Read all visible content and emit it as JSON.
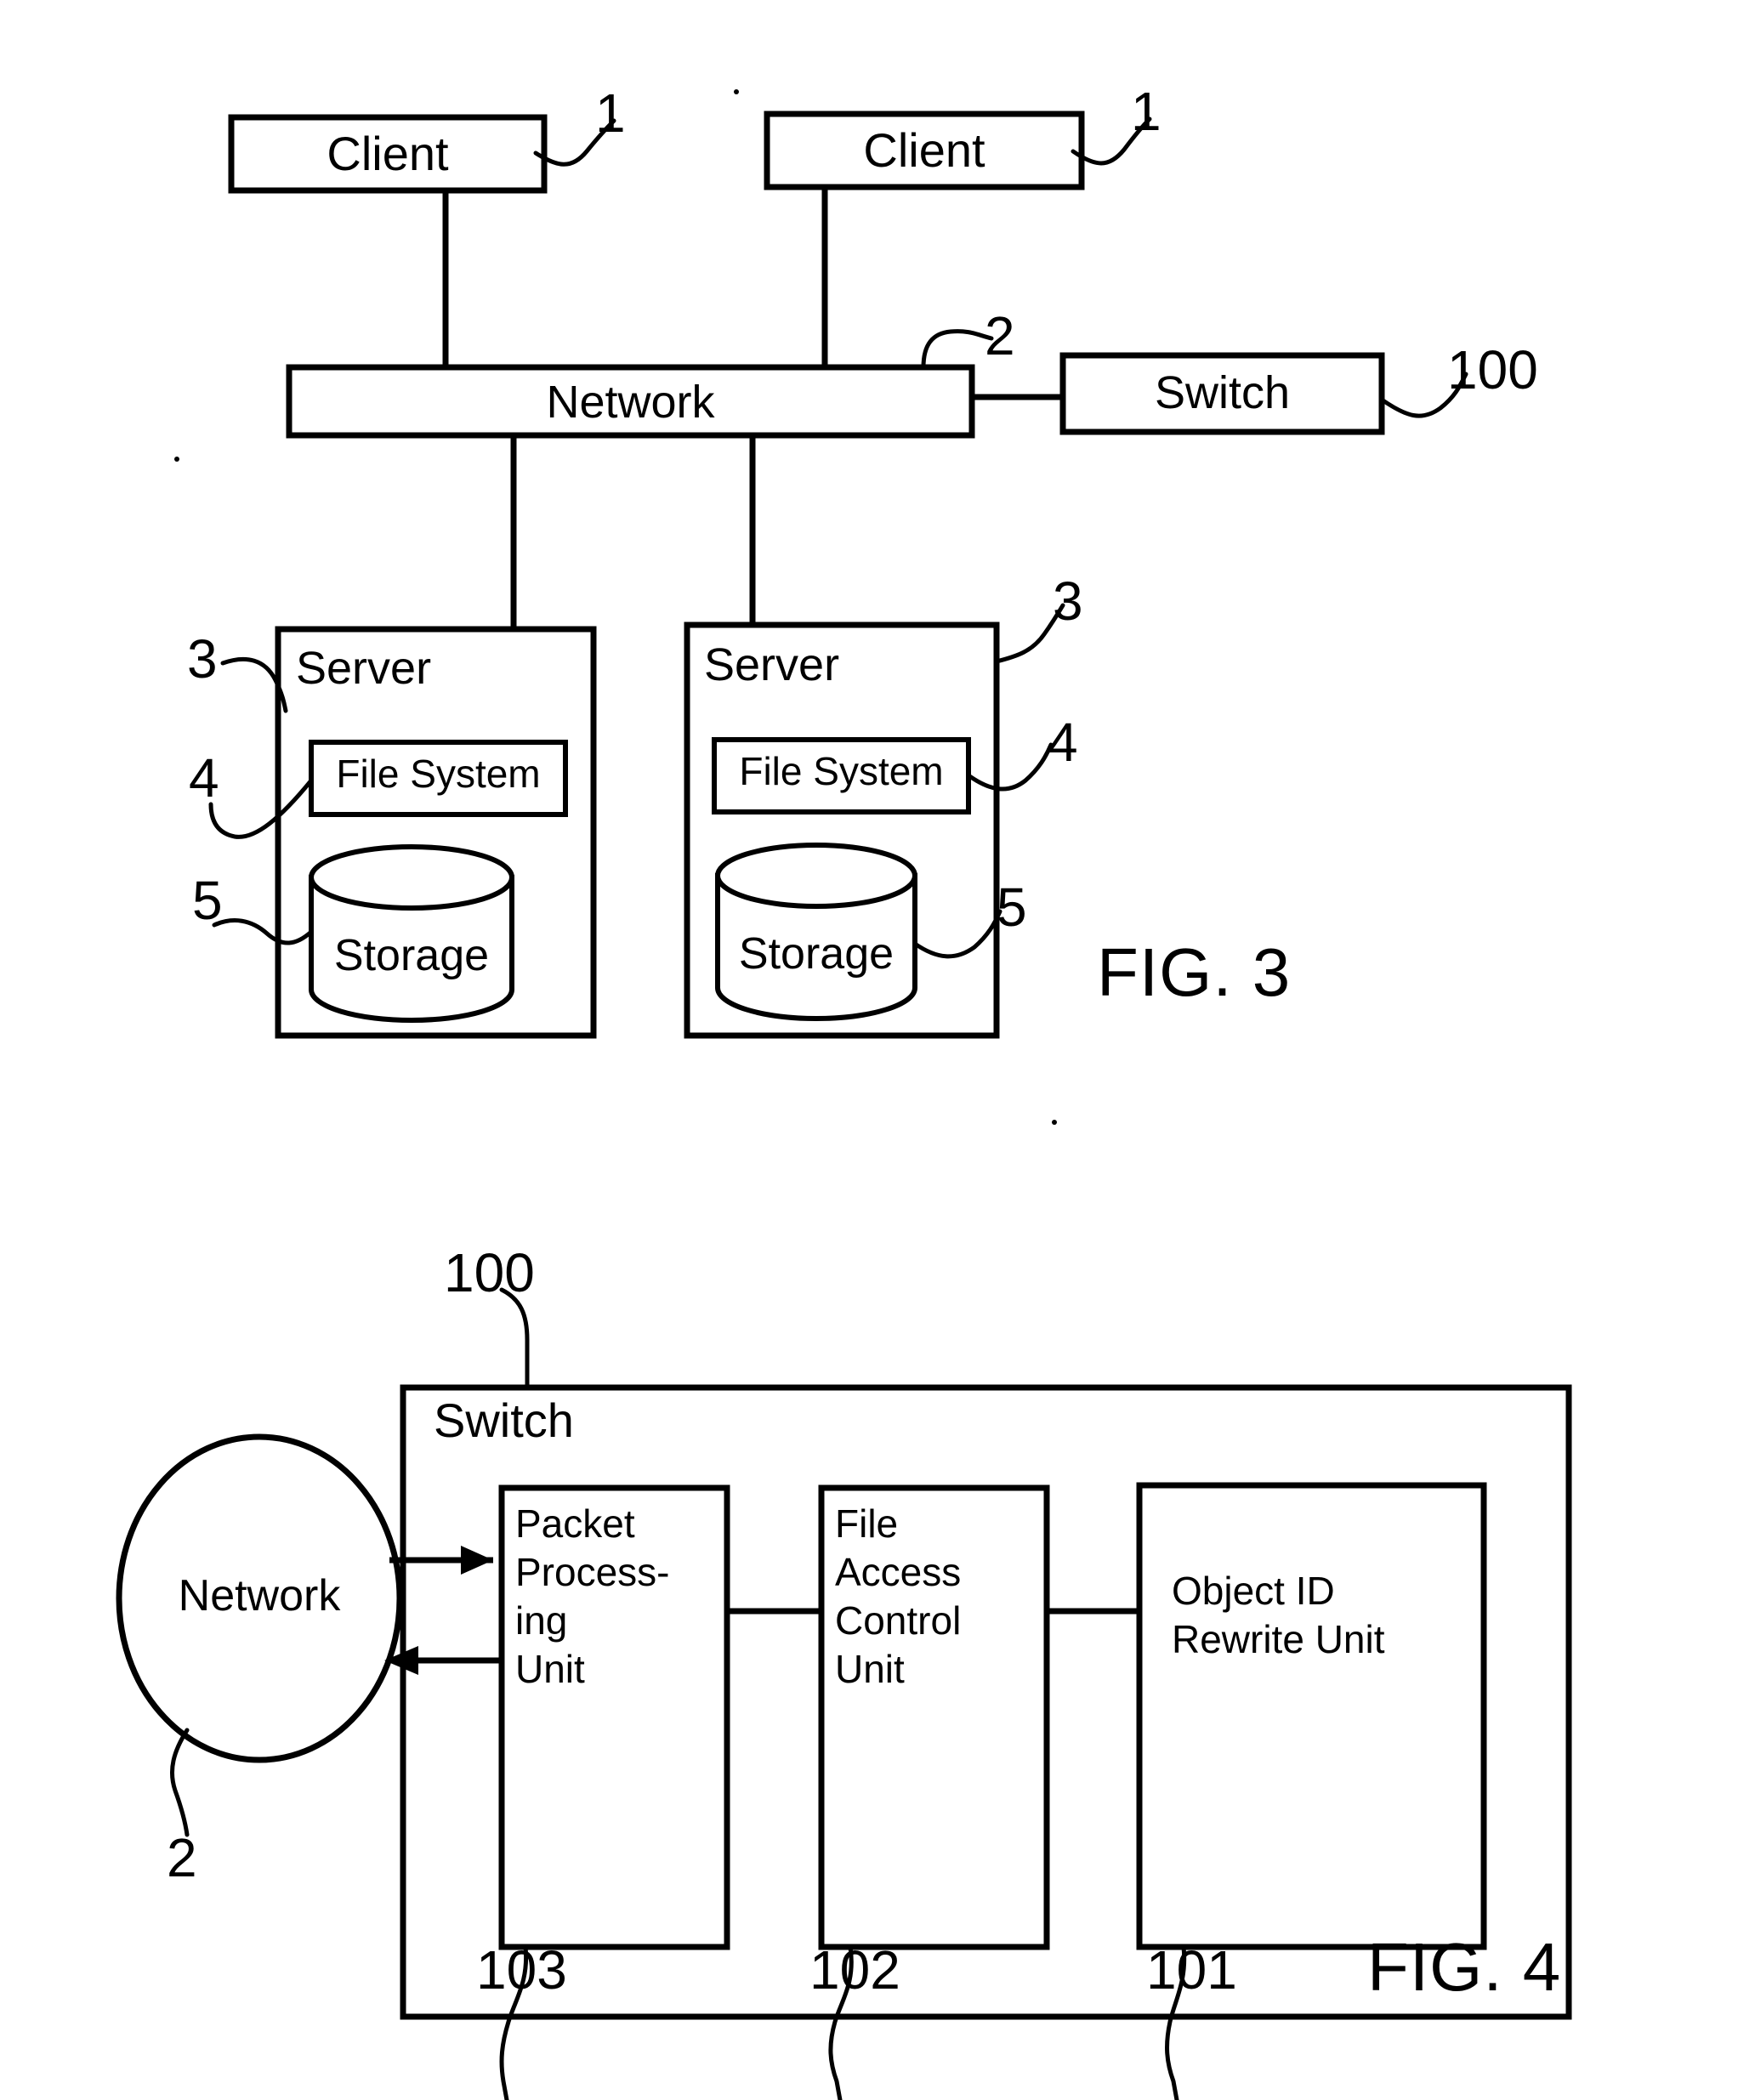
{
  "figures": [
    {
      "id": "fig3",
      "caption": "FIG. 3",
      "nodes": {
        "client_left": "Client",
        "client_right": "Client",
        "network": "Network",
        "switch": "Switch",
        "server_left": "Server",
        "server_right": "Server",
        "file_system_left": "File System",
        "file_system_right": "File System",
        "storage_left": "Storage",
        "storage_right": "Storage"
      },
      "reference_numerals": {
        "client_left": "1",
        "client_right": "1",
        "network": "2",
        "switch": "100",
        "server_left": "3",
        "server_right": "3",
        "file_system_left": "4",
        "file_system_right": "4",
        "storage_left": "5",
        "storage_right": "5"
      }
    },
    {
      "id": "fig4",
      "caption": "FIG. 4",
      "nodes": {
        "network": "Network",
        "switch": "Switch",
        "packet_processing_unit_line1": "Packet",
        "packet_processing_unit_line2": "Process-",
        "packet_processing_unit_line3": "ing",
        "packet_processing_unit_line4": "Unit",
        "file_access_control_unit_line1": "File",
        "file_access_control_unit_line2": "Access",
        "file_access_control_unit_line3": "Control",
        "file_access_control_unit_line4": "Unit",
        "object_id_rewrite_unit_line1": "Object ID",
        "object_id_rewrite_unit_line2": "Rewrite Unit"
      },
      "reference_numerals": {
        "switch": "100",
        "network": "2",
        "packet_processing_unit": "103",
        "file_access_control_unit": "102",
        "object_id_rewrite_unit": "101"
      }
    }
  ],
  "colors": {
    "ink": "#000000",
    "paper": "#ffffff"
  }
}
